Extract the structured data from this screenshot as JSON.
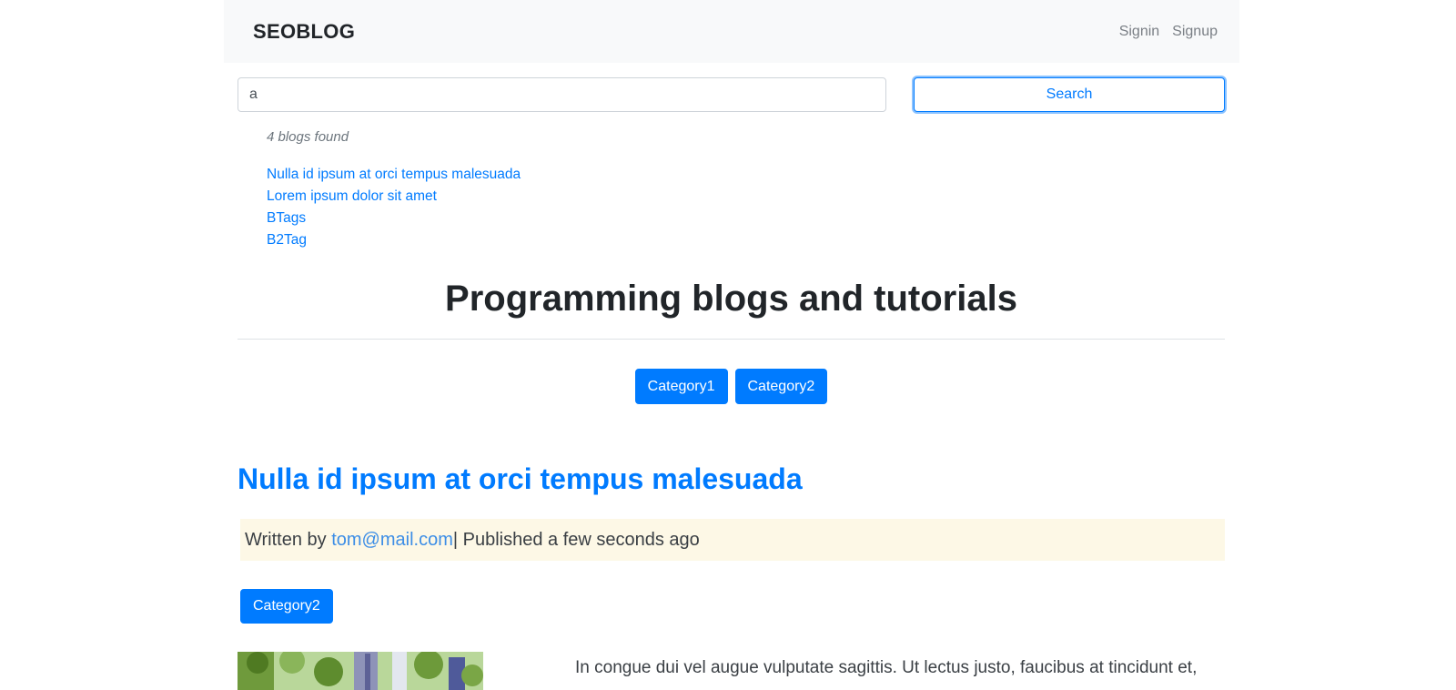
{
  "navbar": {
    "brand": "SEOBLOG",
    "links": [
      "Signin",
      "Signup"
    ]
  },
  "search": {
    "value": "a",
    "button_label": "Search"
  },
  "results": {
    "count_text": "4 blogs found",
    "items": [
      "Nulla id ipsum at orci tempus malesuada",
      "Lorem ipsum dolor sit amet",
      "BTags",
      "B2Tag"
    ]
  },
  "page": {
    "title": "Programming blogs and tutorials",
    "categories": [
      "Category1",
      "Category2"
    ]
  },
  "post": {
    "title": "Nulla id ipsum at orci tempus malesuada",
    "meta_prefix": "Written by ",
    "author": "tom@mail.com",
    "meta_suffix": "| Published a few seconds ago",
    "category": "Category2",
    "excerpt": "In congue dui vel augue vulputate sagittis. Ut lectus justo, faucibus at tincidunt et,"
  },
  "colors": {
    "primary": "#007bff",
    "navbar_bg": "#f8f9fa",
    "meta_bg": "#fdf8e6"
  }
}
